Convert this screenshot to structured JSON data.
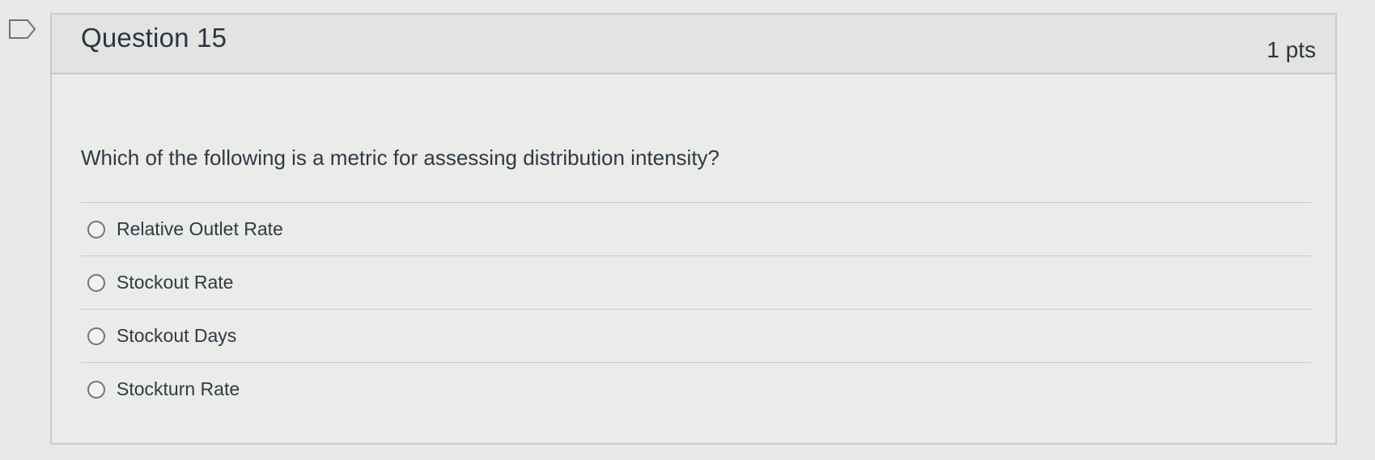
{
  "question": {
    "title": "Question 15",
    "points": "1 pts",
    "text": "Which of the following is a metric for assessing distribution intensity?",
    "answers": [
      {
        "label": "Relative Outlet Rate"
      },
      {
        "label": "Stockout Rate"
      },
      {
        "label": "Stockout Days"
      },
      {
        "label": "Stockturn Rate"
      }
    ]
  },
  "icons": {
    "flag": "flag-question-icon"
  }
}
